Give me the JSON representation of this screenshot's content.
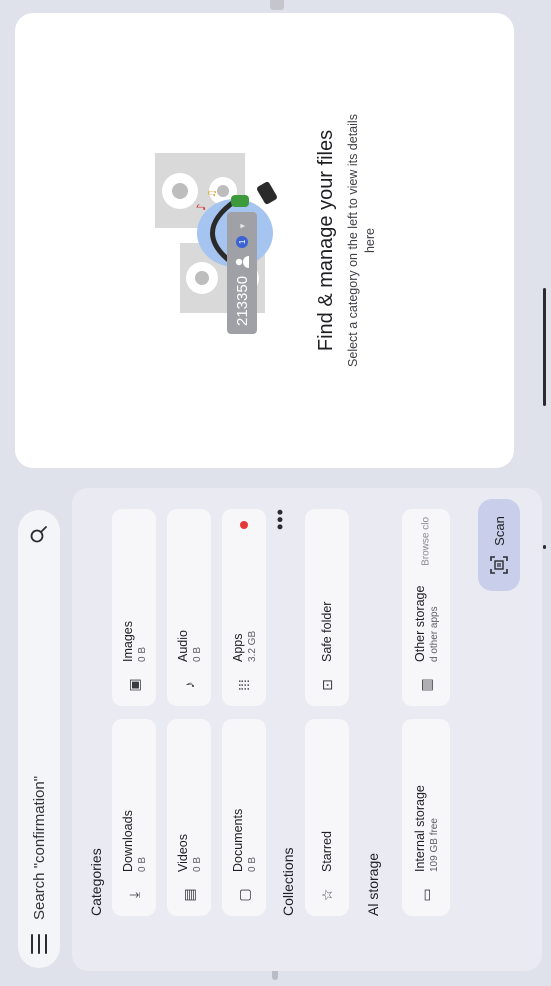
{
  "search": {
    "placeholder": "Search \"confirmation\""
  },
  "categories": {
    "title": "Categories",
    "items": [
      {
        "label": "Downloads",
        "sub": "0 B",
        "icon": "download-icon"
      },
      {
        "label": "Images",
        "sub": "0 B",
        "icon": "image-icon"
      },
      {
        "label": "Videos",
        "sub": "0 B",
        "icon": "video-icon"
      },
      {
        "label": "Audio",
        "sub": "0 B",
        "icon": "music-note-icon"
      },
      {
        "label": "Documents",
        "sub": "0 B",
        "icon": "document-icon"
      },
      {
        "label": "Apps",
        "sub": "3.2 GB",
        "icon": "apps-grid-icon",
        "badge_color": "#e53935"
      }
    ]
  },
  "collections": {
    "title": "Collections",
    "items": [
      {
        "label": "Starred",
        "icon": "star-icon"
      },
      {
        "label": "Safe folder",
        "icon": "lock-icon"
      }
    ]
  },
  "storage": {
    "title": "Al storage",
    "items": [
      {
        "label": "Internal storage",
        "sub": "109 GB free",
        "icon": "storage-icon"
      },
      {
        "label": "Other storage",
        "sub": "d other apps",
        "icon": "other-storage-icon",
        "action": "Browse clo"
      }
    ]
  },
  "scan": {
    "label": "Scan"
  },
  "detail": {
    "title": "Find & manage your files",
    "description": "Select a category on the left to view its details here"
  },
  "account_chip": {
    "label": "213350",
    "badge": "1"
  },
  "colors": {
    "accent": "#c9ceea",
    "badge": "#e53935",
    "panel": "#e9eaf2",
    "background": "#dfe2ea"
  }
}
